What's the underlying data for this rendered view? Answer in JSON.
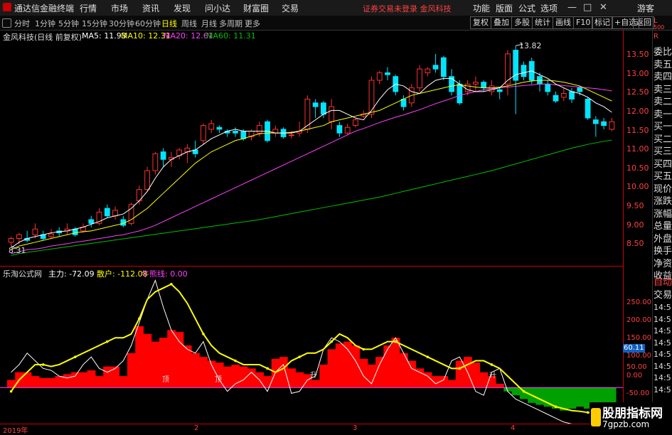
{
  "app": {
    "title": "通达信金融终端"
  },
  "menu": [
    "行情",
    "市场",
    "资讯",
    "发现",
    "问小达",
    "财富圈",
    "交易"
  ],
  "status_message": "证券交易未登录 金风科技",
  "right_menu": [
    "功能",
    "版面",
    "公式",
    "选项"
  ],
  "guest_label": "游客",
  "window_buttons": {
    "minimize": "—",
    "maximize": "□",
    "close": "✕"
  },
  "periods": [
    {
      "label": "分时",
      "active": false
    },
    {
      "label": "1分钟",
      "active": false
    },
    {
      "label": "5分钟",
      "active": false
    },
    {
      "label": "15分钟",
      "active": false
    },
    {
      "label": "30分钟",
      "active": false
    },
    {
      "label": "60分钟",
      "active": false
    },
    {
      "label": "日线",
      "active": true
    },
    {
      "label": "周线",
      "active": false
    },
    {
      "label": "月线",
      "active": false
    },
    {
      "label": "多周期",
      "active": false
    },
    {
      "label": "更多",
      "active": false
    }
  ],
  "toolbar_buttons": [
    "复权",
    "叠加",
    "多股",
    "统计",
    "画线",
    "F10",
    "标记",
    "+自选",
    "返回"
  ],
  "price_chart": {
    "name": "金风科技(日线 前复权)",
    "ma_legend": [
      {
        "label": "MA5: 11.93",
        "color": "#ffffff"
      },
      {
        "label": "MA10: 12.31",
        "color": "#ffff00"
      },
      {
        "label": "MA20: 12.61",
        "color": "#ff40ff"
      },
      {
        "label": "MA60: 11.31",
        "color": "#00c000"
      }
    ],
    "high_label": "13.82",
    "low_label": "8.31",
    "axis_ticks": [
      "13.50",
      "13.00",
      "12.50",
      "12.00",
      "11.50",
      "11.00",
      "10.50",
      "10.00",
      "9.50",
      "9.00",
      "8.50"
    ]
  },
  "indicator": {
    "name": "乐淘公式网",
    "legend": [
      {
        "label": "主力: -72.09",
        "color": "#ffffff"
      },
      {
        "label": "散户: -112.08",
        "color": "#ffff00"
      },
      {
        "label": "牛熊线: 0.00",
        "color": "#ff40ff"
      }
    ],
    "axis_ticks": [
      "250.00",
      "200.00",
      "150.00",
      "100.00",
      "50.00",
      "0.00",
      "-50.00"
    ],
    "current_value": "60.11",
    "signals": [
      "顶",
      "顶",
      "升",
      "升"
    ]
  },
  "side_panel": {
    "top": [
      "L",
      "500",
      "R"
    ],
    "items": [
      "委比",
      "卖五",
      "卖四",
      "卖三",
      "卖二",
      "卖一",
      "买一",
      "买二",
      "买三",
      "买四",
      "买五",
      "现价",
      "涨跌",
      "涨幅",
      "总量",
      "外盘",
      "换手",
      "净资",
      "收益"
    ],
    "auto_label": "自动",
    "trade_label": "交易",
    "times": [
      "14:5",
      "14:5",
      "14:5",
      "14:5",
      "14:5",
      "14:5",
      "14:5",
      "14:5"
    ]
  },
  "date_axis": [
    "2019年",
    "2",
    "3",
    "4"
  ],
  "watermark": {
    "line1": "股朋指标网",
    "line2": "7gpzb.com"
  },
  "colors": {
    "up": "#ff3030",
    "down": "#00e5ff",
    "ma5": "#ffffff",
    "ma10": "#ffff00",
    "ma20": "#ff40ff",
    "ma60": "#00c000",
    "bull": "#ff0000",
    "bear": "#00a000"
  },
  "chart_data": {
    "type": "candlestick",
    "y_range": [
      8.2,
      13.9
    ],
    "candles": [
      [
        8.6,
        8.7,
        8.5,
        8.75
      ],
      [
        8.7,
        8.8,
        8.55,
        8.85
      ],
      [
        8.7,
        8.65,
        8.6,
        8.9
      ],
      [
        8.8,
        8.95,
        8.7,
        9.1
      ],
      [
        8.8,
        8.7,
        8.65,
        8.9
      ],
      [
        8.75,
        8.82,
        8.7,
        8.95
      ],
      [
        8.9,
        8.85,
        8.75,
        9.0
      ],
      [
        8.9,
        8.95,
        8.8,
        9.1
      ],
      [
        8.95,
        8.8,
        8.75,
        9.0
      ],
      [
        8.9,
        9.0,
        8.85,
        9.1
      ],
      [
        9.2,
        9.1,
        9.0,
        9.3
      ],
      [
        9.1,
        9.4,
        9.05,
        9.5
      ],
      [
        9.5,
        9.3,
        9.25,
        9.6
      ],
      [
        9.3,
        9.45,
        9.2,
        9.55
      ],
      [
        9.2,
        9.05,
        9.0,
        9.3
      ],
      [
        9.1,
        9.6,
        9.05,
        9.65
      ],
      [
        9.7,
        10.0,
        9.6,
        10.1
      ],
      [
        10.0,
        10.5,
        9.95,
        10.6
      ],
      [
        10.5,
        10.95,
        10.4,
        11.0
      ],
      [
        11.0,
        10.8,
        10.6,
        11.1
      ],
      [
        10.8,
        10.85,
        10.6,
        11.0
      ],
      [
        10.9,
        11.05,
        10.8,
        11.1
      ],
      [
        11.0,
        11.1,
        10.7,
        11.2
      ],
      [
        11.05,
        10.95,
        10.85,
        11.3
      ],
      [
        11.3,
        11.7,
        11.2,
        11.75
      ],
      [
        11.6,
        11.75,
        11.5,
        11.85
      ],
      [
        11.65,
        11.6,
        11.5,
        11.7
      ],
      [
        11.55,
        11.5,
        11.4,
        11.6
      ],
      [
        11.55,
        11.5,
        11.4,
        11.65
      ],
      [
        11.55,
        11.35,
        11.3,
        11.6
      ],
      [
        11.4,
        11.55,
        11.3,
        11.6
      ],
      [
        11.5,
        11.7,
        11.4,
        11.8
      ],
      [
        11.8,
        11.3,
        11.25,
        11.85
      ],
      [
        11.5,
        11.6,
        11.4,
        11.7
      ],
      [
        11.6,
        11.4,
        11.35,
        11.65
      ],
      [
        11.45,
        11.45,
        11.35,
        11.55
      ],
      [
        11.5,
        11.55,
        11.4,
        11.8
      ],
      [
        11.6,
        12.4,
        11.5,
        12.5
      ],
      [
        12.3,
        12.2,
        11.9,
        12.4
      ],
      [
        12.3,
        12.0,
        11.9,
        12.35
      ],
      [
        11.8,
        12.2,
        11.6,
        12.4
      ],
      [
        11.7,
        11.5,
        11.4,
        11.8
      ],
      [
        11.5,
        11.65,
        11.45,
        11.75
      ],
      [
        11.7,
        11.85,
        11.65,
        11.9
      ],
      [
        11.95,
        12.0,
        11.9,
        12.1
      ],
      [
        12.0,
        12.9,
        11.9,
        13.0
      ],
      [
        12.9,
        13.1,
        12.8,
        13.15
      ],
      [
        13.1,
        13.05,
        12.9,
        13.25
      ],
      [
        13.0,
        12.6,
        12.5,
        13.05
      ],
      [
        12.4,
        12.2,
        12.1,
        12.5
      ],
      [
        12.3,
        12.7,
        12.2,
        12.8
      ],
      [
        12.7,
        13.2,
        12.6,
        13.3
      ],
      [
        13.1,
        13.2,
        13.0,
        13.25
      ],
      [
        13.3,
        13.2,
        13.1,
        13.6
      ],
      [
        13.5,
        13.0,
        12.9,
        13.55
      ],
      [
        13.0,
        12.6,
        12.5,
        13.2
      ],
      [
        12.8,
        12.3,
        12.25,
        12.9
      ],
      [
        12.6,
        12.8,
        12.5,
        12.9
      ],
      [
        12.8,
        12.85,
        12.6,
        13.0
      ],
      [
        12.85,
        12.7,
        12.6,
        12.9
      ],
      [
        12.6,
        12.75,
        12.5,
        12.9
      ],
      [
        12.65,
        12.6,
        12.4,
        12.7
      ],
      [
        12.8,
        13.6,
        12.5,
        13.7
      ],
      [
        13.7,
        12.9,
        12.0,
        13.82
      ],
      [
        13.3,
        13.0,
        12.9,
        13.4
      ],
      [
        13.4,
        12.9,
        12.8,
        13.5
      ],
      [
        13.0,
        12.8,
        12.6,
        13.1
      ],
      [
        12.8,
        12.6,
        12.5,
        12.9
      ],
      [
        12.5,
        12.35,
        12.3,
        12.6
      ],
      [
        12.45,
        12.55,
        12.35,
        12.7
      ],
      [
        12.6,
        12.4,
        12.3,
        12.7
      ],
      [
        12.7,
        12.6,
        12.5,
        12.75
      ],
      [
        12.4,
        11.9,
        11.85,
        12.45
      ],
      [
        11.85,
        11.75,
        11.4,
        11.95
      ],
      [
        11.8,
        11.7,
        11.6,
        11.9
      ],
      [
        11.6,
        11.8,
        11.55,
        11.9
      ]
    ],
    "ma5": [
      8.45,
      8.6,
      8.7,
      8.75,
      8.8,
      8.85,
      8.88,
      8.9,
      8.95,
      9.0,
      9.08,
      9.15,
      9.25,
      9.3,
      9.35,
      9.5,
      9.7,
      9.95,
      10.3,
      10.6,
      10.8,
      10.9,
      11.0,
      11.05,
      11.2,
      11.35,
      11.45,
      11.55,
      11.6,
      11.55,
      11.55,
      11.55,
      11.55,
      11.5,
      11.5,
      11.5,
      11.55,
      11.7,
      11.85,
      12.0,
      12.1,
      12.1,
      12.0,
      11.9,
      11.85,
      12.1,
      12.4,
      12.65,
      12.8,
      12.75,
      12.6,
      12.55,
      12.75,
      12.9,
      12.95,
      12.95,
      12.8,
      12.65,
      12.6,
      12.6,
      12.65,
      12.7,
      12.9,
      13.05,
      13.1,
      13.15,
      13.05,
      12.95,
      12.8,
      12.7,
      12.6,
      12.55,
      12.45,
      12.3,
      12.2,
      12.05
    ],
    "ma10": [
      8.4,
      8.5,
      8.55,
      8.6,
      8.65,
      8.7,
      8.75,
      8.8,
      8.85,
      8.88,
      8.9,
      8.95,
      9.0,
      9.05,
      9.1,
      9.2,
      9.35,
      9.5,
      9.7,
      9.9,
      10.1,
      10.3,
      10.5,
      10.7,
      10.85,
      11.0,
      11.1,
      11.2,
      11.3,
      11.35,
      11.42,
      11.48,
      11.5,
      11.5,
      11.5,
      11.52,
      11.55,
      11.6,
      11.65,
      11.7,
      11.8,
      11.85,
      11.9,
      11.95,
      12.0,
      12.05,
      12.1,
      12.2,
      12.3,
      12.4,
      12.5,
      12.55,
      12.6,
      12.65,
      12.7,
      12.75,
      12.78,
      12.75,
      12.72,
      12.7,
      12.7,
      12.72,
      12.75,
      12.8,
      12.85,
      12.88,
      12.9,
      12.9,
      12.88,
      12.85,
      12.8,
      12.75,
      12.65,
      12.55,
      12.45,
      12.35
    ],
    "ma20": [
      8.3,
      8.35,
      8.4,
      8.42,
      8.45,
      8.5,
      8.53,
      8.56,
      8.6,
      8.63,
      8.66,
      8.7,
      8.73,
      8.77,
      8.8,
      8.85,
      8.9,
      8.97,
      9.05,
      9.15,
      9.25,
      9.35,
      9.45,
      9.55,
      9.65,
      9.75,
      9.85,
      9.95,
      10.05,
      10.15,
      10.25,
      10.35,
      10.45,
      10.55,
      10.65,
      10.75,
      10.85,
      10.95,
      11.05,
      11.15,
      11.25,
      11.35,
      11.45,
      11.55,
      11.62,
      11.7,
      11.78,
      11.85,
      11.92,
      11.98,
      12.05,
      12.12,
      12.2,
      12.28,
      12.35,
      12.42,
      12.5,
      12.55,
      12.6,
      12.65,
      12.68,
      12.7,
      12.72,
      12.74,
      12.76,
      12.78,
      12.8,
      12.8,
      12.78,
      12.76,
      12.74,
      12.72,
      12.7,
      12.68,
      12.65,
      12.62
    ],
    "ma60": [
      8.25,
      8.3,
      8.33,
      8.36,
      8.39,
      8.42,
      8.45,
      8.48,
      8.51,
      8.54,
      8.57,
      8.6,
      8.63,
      8.66,
      8.69,
      8.72,
      8.75,
      8.78,
      8.81,
      8.84,
      8.87,
      8.9,
      8.93,
      8.96,
      8.99,
      9.02,
      9.05,
      9.08,
      9.11,
      9.14,
      9.17,
      9.2,
      9.24,
      9.28,
      9.32,
      9.36,
      9.4,
      9.44,
      9.48,
      9.52,
      9.56,
      9.6,
      9.64,
      9.68,
      9.72,
      9.76,
      9.8,
      9.85,
      9.9,
      9.95,
      10.0,
      10.05,
      10.1,
      10.15,
      10.2,
      10.25,
      10.3,
      10.35,
      10.4,
      10.45,
      10.5,
      10.56,
      10.62,
      10.68,
      10.74,
      10.8,
      10.86,
      10.92,
      10.98,
      11.04,
      11.1,
      11.15,
      11.2,
      11.24,
      11.28,
      11.31
    ],
    "ind_y_range": [
      -70,
      290
    ],
    "bars": [
      20,
      40,
      40,
      30,
      25,
      25,
      30,
      35,
      40,
      40,
      45,
      30,
      55,
      55,
      30,
      90,
      160,
      140,
      120,
      130,
      150,
      145,
      110,
      90,
      80,
      70,
      65,
      55,
      60,
      55,
      50,
      40,
      30,
      75,
      80,
      50,
      40,
      35,
      20,
      60,
      100,
      115,
      120,
      110,
      75,
      60,
      80,
      110,
      130,
      90,
      70,
      50,
      40,
      30,
      30,
      20,
      70,
      80,
      65,
      40,
      30,
      10,
      -10,
      -20,
      -30,
      -40,
      -45,
      -50,
      -55,
      -60,
      -55,
      -50,
      -55,
      -55,
      -55,
      -55
    ],
    "main_line": [
      40,
      60,
      90,
      70,
      50,
      45,
      30,
      25,
      30,
      60,
      80,
      50,
      40,
      50,
      70,
      110,
      170,
      230,
      280,
      210,
      150,
      120,
      100,
      90,
      120,
      60,
      20,
      -10,
      10,
      20,
      40,
      20,
      -10,
      40,
      60,
      -15,
      -10,
      20,
      30,
      100,
      130,
      120,
      100,
      70,
      30,
      10,
      60,
      100,
      130,
      90,
      50,
      40,
      30,
      10,
      20,
      70,
      80,
      40,
      -10,
      -20,
      40,
      50,
      -10,
      -30,
      -40,
      -50,
      -60,
      -70,
      -80,
      -90,
      -95,
      -100,
      -105,
      -110,
      -112,
      -112
    ],
    "retail_line": [
      -10,
      20,
      40,
      60,
      60,
      55,
      60,
      70,
      80,
      90,
      100,
      110,
      120,
      130,
      130,
      140,
      180,
      230,
      250,
      260,
      270,
      250,
      220,
      180,
      140,
      110,
      90,
      80,
      70,
      60,
      60,
      60,
      50,
      40,
      50,
      70,
      80,
      90,
      90,
      100,
      120,
      140,
      130,
      110,
      100,
      100,
      110,
      120,
      120,
      110,
      100,
      90,
      80,
      70,
      60,
      50,
      50,
      60,
      70,
      70,
      60,
      50,
      30,
      10,
      -10,
      -20,
      -30,
      -40,
      -50,
      -55,
      -60,
      -62,
      -65,
      -67,
      -70,
      -72
    ]
  }
}
